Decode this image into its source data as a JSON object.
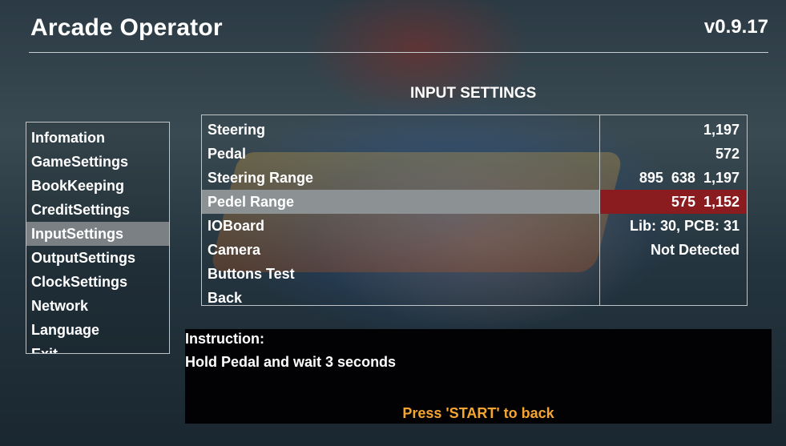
{
  "header": {
    "app_title": "Arcade Operator",
    "version": "v0.9.17"
  },
  "section_title": "INPUT SETTINGS",
  "nav": {
    "items": [
      {
        "label": "Infomation"
      },
      {
        "label": "GameSettings"
      },
      {
        "label": "BookKeeping"
      },
      {
        "label": "CreditSettings"
      },
      {
        "label": "InputSettings",
        "active": true
      },
      {
        "label": "OutputSettings"
      },
      {
        "label": "ClockSettings"
      },
      {
        "label": "Network"
      },
      {
        "label": "Language"
      },
      {
        "label": "Exit"
      }
    ]
  },
  "settings": {
    "rows": [
      {
        "label": "Steering",
        "value": "1,197"
      },
      {
        "label": "Pedal",
        "value": "572"
      },
      {
        "label": "Steering Range",
        "value": "895  638  1,197"
      },
      {
        "label": "Pedel Range",
        "value": "575  1,152",
        "selected": true
      },
      {
        "label": "IOBoard",
        "value": "Lib: 30, PCB: 31"
      },
      {
        "label": "Camera",
        "value": "Not Detected"
      },
      {
        "label": "Buttons Test",
        "value": ""
      },
      {
        "label": "Back",
        "value": ""
      }
    ]
  },
  "instruction": {
    "heading": "Instruction:",
    "text": "Hold Pedal and wait 3 seconds",
    "footer": "Press 'START' to back"
  },
  "colors": {
    "selected_label_bg": "#8c9194",
    "selected_value_bg": "#8a1b1e",
    "active_nav_bg": "#7b8085",
    "footer_text": "#f5a531"
  }
}
